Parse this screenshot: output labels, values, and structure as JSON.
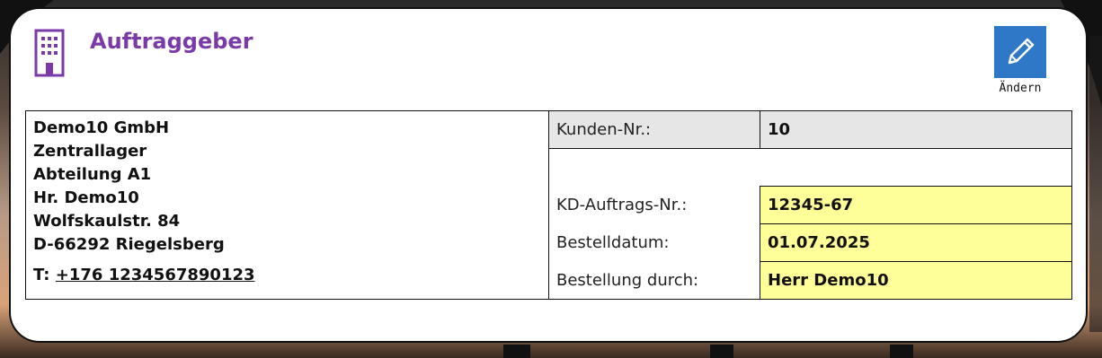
{
  "header": {
    "title": "Auftraggeber",
    "edit_label": "Ändern",
    "title_color": "#7a3aa8",
    "button_color": "#2f78c8"
  },
  "address": {
    "lines": [
      "Demo10 GmbH",
      "Zentrallager",
      "Abteilung A1",
      "Hr. Demo10",
      "Wolfskaulstr. 84",
      "D-66292 Riegelsberg"
    ],
    "phone_prefix": "T:",
    "phone": "+176 1234567890123"
  },
  "details": {
    "customer_no_label": "Kunden-Nr.:",
    "customer_no": "10",
    "order_no_label": "KD-Auftrags-Nr.:",
    "order_no": "12345-67",
    "order_date_label": "Bestelldatum:",
    "order_date": "01.07.2025",
    "ordered_by_label": "Bestellung durch:",
    "ordered_by": "Herr Demo10"
  },
  "colors": {
    "highlight": "#ffff99",
    "header_row": "#e6e6e6"
  },
  "icons": {
    "building": "building-icon",
    "edit": "pencil-icon"
  }
}
